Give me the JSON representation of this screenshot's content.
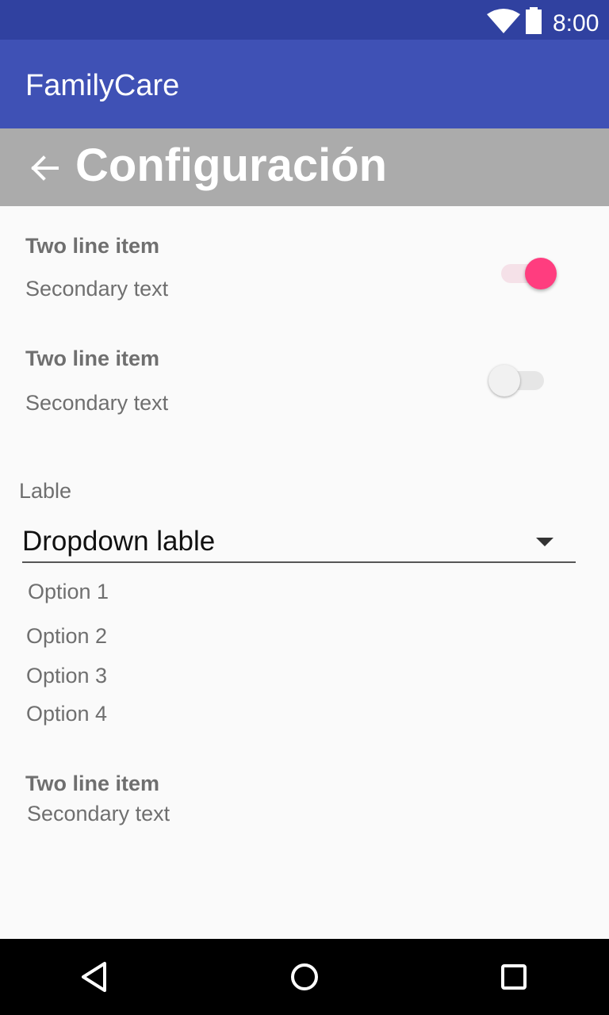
{
  "status_bar": {
    "time": "8:00",
    "icons": [
      "wifi-icon",
      "battery-icon"
    ]
  },
  "app_bar": {
    "title": "FamilyCare"
  },
  "header": {
    "title": "Configuración",
    "back_icon": "arrow-back-icon"
  },
  "settings": [
    {
      "primary": "Two line item",
      "secondary": "Secondary text",
      "switch_on": true
    },
    {
      "primary": "Two line item",
      "secondary": "Secondary text",
      "switch_on": false
    }
  ],
  "dropdown": {
    "label": "Lable",
    "value": "Dropdown lable",
    "options": [
      "Option 1",
      "Option 2",
      "Option 3",
      "Option 4"
    ]
  },
  "footer_item": {
    "primary": "Two line item",
    "secondary": "Secondary text"
  },
  "nav": {
    "icons": [
      "back-triangle-icon",
      "home-circle-icon",
      "recents-square-icon"
    ]
  },
  "colors": {
    "status_bar": "#3041a0",
    "app_bar": "#3f51b5",
    "header": "#ababab",
    "switch_accent": "#ff3d7f"
  }
}
